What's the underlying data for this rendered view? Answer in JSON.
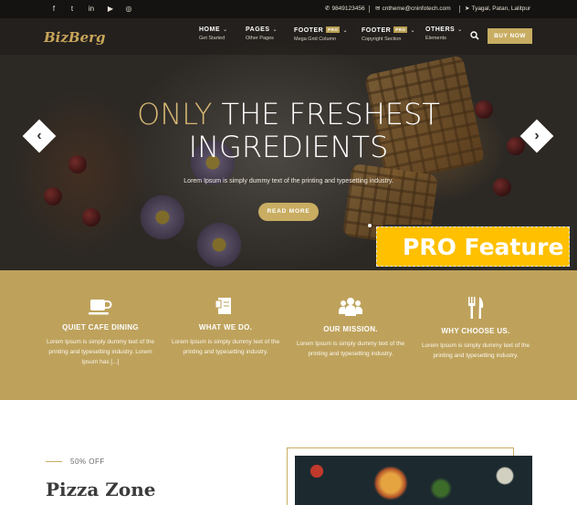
{
  "topbar": {
    "social": [
      {
        "icon": "facebook-icon",
        "glyph": "f"
      },
      {
        "icon": "twitter-icon",
        "glyph": "t"
      },
      {
        "icon": "linkedin-icon",
        "glyph": "in"
      },
      {
        "icon": "youtube-icon",
        "glyph": "▶"
      },
      {
        "icon": "instagram-icon",
        "glyph": "◎"
      }
    ],
    "phone": "9849123456",
    "email": "cntheme@cninfotech.com",
    "location": "Tyagal, Patan, Lalitpur"
  },
  "nav": {
    "logo": "BizBerg",
    "items": [
      {
        "label": "HOME",
        "sub": "Get Started",
        "tag": ""
      },
      {
        "label": "PAGES",
        "sub": "Other Pages",
        "tag": ""
      },
      {
        "label": "FOOTER",
        "sub": "Mega Grid Column",
        "tag": "PRO"
      },
      {
        "label": "FOOTER",
        "sub": "Copyright Section",
        "tag": "PRO"
      },
      {
        "label": "OTHERS",
        "sub": "Elements",
        "tag": ""
      }
    ],
    "buy_now": "BUY NOW"
  },
  "hero": {
    "headline_accent": "ONLY",
    "headline_rest": "THE FRESHEST",
    "headline_line2": "INGREDIENTS",
    "description": "Lorem Ipsum is simply dummy text of the printing and typesetting industry.",
    "read_more": "READ MORE",
    "prev_glyph": "‹",
    "next_glyph": "›"
  },
  "pro_badge": "PRO Feature",
  "features": [
    {
      "icon": "coffee-cup-icon",
      "title": "QUIET CAFE DINING",
      "text": "Lorem Ipsum is simply dummy text of the printing and typesetting industry. Lorem Ipsum has [...]"
    },
    {
      "icon": "document-icon",
      "title": "WHAT WE DO.",
      "text": "Lorem Ipsum is simply dummy text of the printing and typesetting industry."
    },
    {
      "icon": "team-icon",
      "title": "OUR MISSION.",
      "text": "Lorem Ipsum is simply dummy text of the printing and typesetting industry."
    },
    {
      "icon": "fork-knife-icon",
      "title": "WHY CHOOSE US.",
      "text": "Lorem Ipsum is simply dummy text of the printing and typesetting industry."
    }
  ],
  "promo": {
    "discount": "50% OFF",
    "title": "Pizza Zone"
  },
  "colors": {
    "accent": "#c8ad62",
    "feature_band": "#bea25c",
    "pro_yellow": "#ffc000"
  }
}
